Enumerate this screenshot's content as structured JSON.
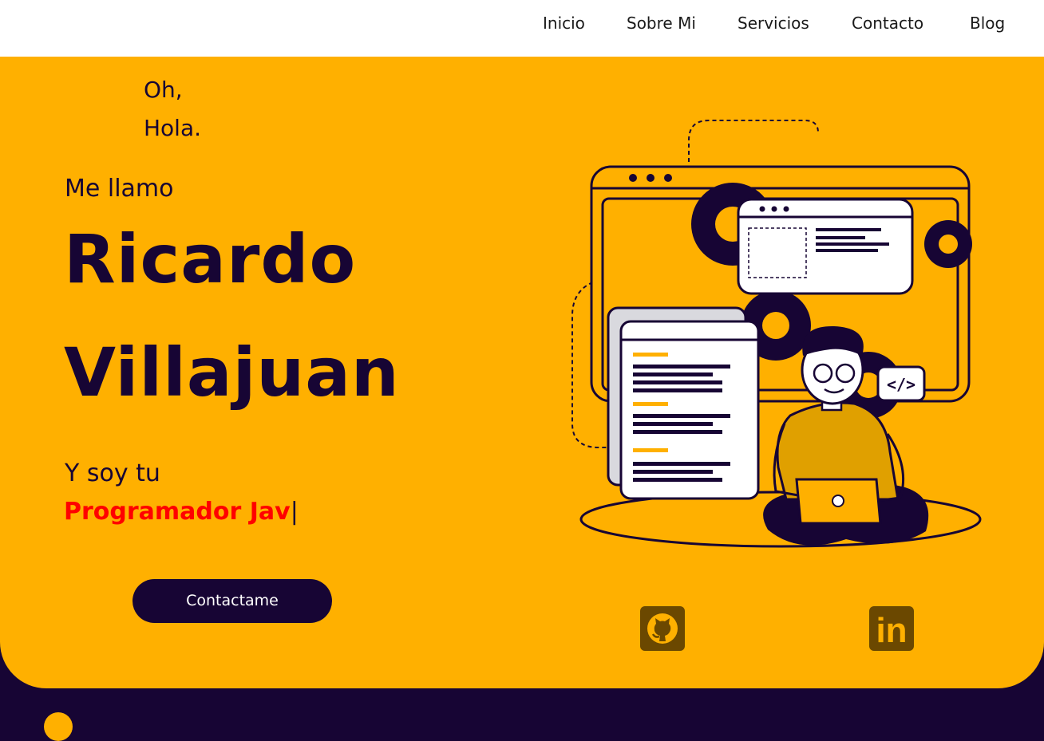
{
  "nav": {
    "items": [
      {
        "label": "Inicio"
      },
      {
        "label": "Sobre Mi"
      },
      {
        "label": "Servicios"
      },
      {
        "label": "Contacto"
      },
      {
        "label": "Blog"
      }
    ]
  },
  "hero": {
    "greeting_line1": "Oh,",
    "greeting_line2": "Hola.",
    "intro": "Me llamo",
    "first_name": "Ricardo",
    "last_name": "Villajuan",
    "role_intro": "Y soy tu",
    "role_typed": "Programador Jav",
    "caret": "|",
    "contact_button": "Contactame",
    "illustration_code_tag": "</>"
  },
  "social": {
    "github_icon": "github-icon",
    "linkedin_icon": "linkedin-icon",
    "linkedin_text": "in"
  },
  "colors": {
    "accent": "#FFB000",
    "dark": "#170534",
    "highlight": "#FF0000",
    "icon_bg": "#6B4800"
  }
}
